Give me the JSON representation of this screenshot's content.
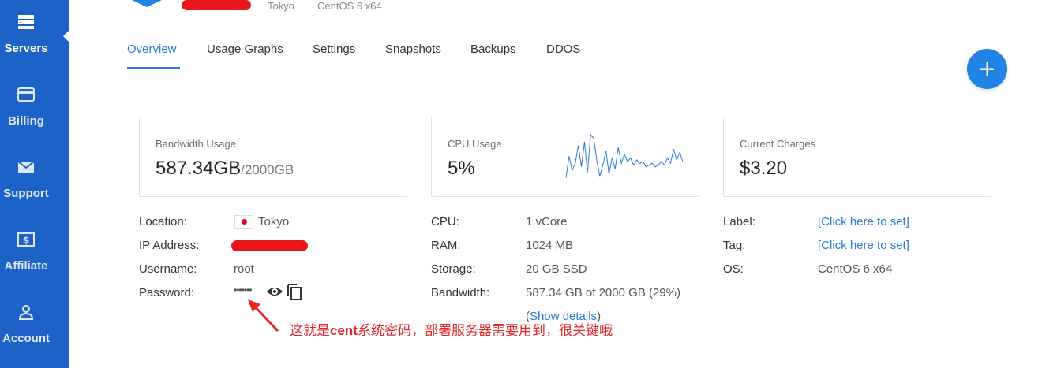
{
  "sidebar": {
    "items": [
      {
        "label": "Servers",
        "icon": "servers-icon",
        "active": true
      },
      {
        "label": "Billing",
        "icon": "credit-card-icon",
        "active": false
      },
      {
        "label": "Support",
        "icon": "envelope-icon",
        "active": false
      },
      {
        "label": "Affiliate",
        "icon": "dollar-icon",
        "active": false
      },
      {
        "label": "Account",
        "icon": "user-icon",
        "active": false
      }
    ]
  },
  "header": {
    "location": "Tokyo",
    "os": "CentOS 6 x64"
  },
  "tabs": [
    {
      "label": "Overview",
      "active": true
    },
    {
      "label": "Usage Graphs",
      "active": false
    },
    {
      "label": "Settings",
      "active": false
    },
    {
      "label": "Snapshots",
      "active": false
    },
    {
      "label": "Backups",
      "active": false
    },
    {
      "label": "DDOS",
      "active": false
    }
  ],
  "fab": {
    "label": "+"
  },
  "cards": {
    "bandwidth": {
      "title": "Bandwidth Usage",
      "value": "587.34GB",
      "limit": "/2000GB"
    },
    "cpu": {
      "title": "CPU Usage",
      "value": "5%",
      "spark": [
        2,
        14,
        6,
        10,
        20,
        8,
        22,
        5,
        26,
        24,
        12,
        3,
        9,
        17,
        4,
        13,
        7,
        19,
        10,
        15,
        11,
        13,
        9,
        12,
        10,
        11,
        8,
        9,
        10,
        8,
        9,
        11,
        9,
        13,
        10,
        18,
        12,
        16,
        11
      ]
    },
    "charges": {
      "title": "Current Charges",
      "value": "$3.20"
    }
  },
  "info": {
    "col1": [
      {
        "key": "Location:",
        "value": "Tokyo"
      },
      {
        "key": "IP Address:",
        "value": ""
      },
      {
        "key": "Username:",
        "value": "root"
      },
      {
        "key": "Password:",
        "value": "•••••••"
      }
    ],
    "col2": [
      {
        "key": "CPU:",
        "value": "1 vCore"
      },
      {
        "key": "RAM:",
        "value": "1024 MB"
      },
      {
        "key": "Storage:",
        "value": "20 GB SSD"
      },
      {
        "key": "Bandwidth:",
        "value": "587.34 GB of 2000 GB (29%)"
      }
    ],
    "show_details_open": "(",
    "show_details": "Show details",
    "show_details_close": ")",
    "col3": [
      {
        "key": "Label:",
        "value": "[Click here to set]"
      },
      {
        "key": "Tag:",
        "value": "[Click here to set]"
      },
      {
        "key": "OS:",
        "value": "CentOS 6 x64"
      }
    ]
  },
  "annotation": {
    "text_before": "这就是",
    "text_bold": "cent",
    "text_after": "系统密码，部署服务器需要用到，很关键哦"
  },
  "colors": {
    "sidebar": "#1d62c6",
    "accent": "#2b7ad6",
    "fab": "#2183e6",
    "annotation": "#e3262a"
  }
}
